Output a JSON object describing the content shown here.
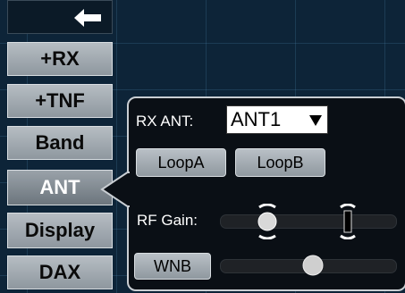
{
  "sidebar": {
    "items": [
      {
        "label": "+RX"
      },
      {
        "label": "+TNF"
      },
      {
        "label": "Band"
      },
      {
        "label": "ANT"
      },
      {
        "label": "Display"
      },
      {
        "label": "DAX"
      }
    ],
    "back_icon": "arrow-left-icon",
    "active": "ANT"
  },
  "ant_panel": {
    "rx_ant_label": "RX ANT:",
    "rx_ant_value": "ANT1",
    "loop_a_label": "LoopA",
    "loop_b_label": "LoopB",
    "rf_gain_label": "RF Gain:",
    "wnb_label": "WNB"
  },
  "colors": {
    "background": "#0d2438",
    "button": "#a3abb2",
    "popup": "#0a0f15",
    "popup_border": "#c9ced3"
  }
}
